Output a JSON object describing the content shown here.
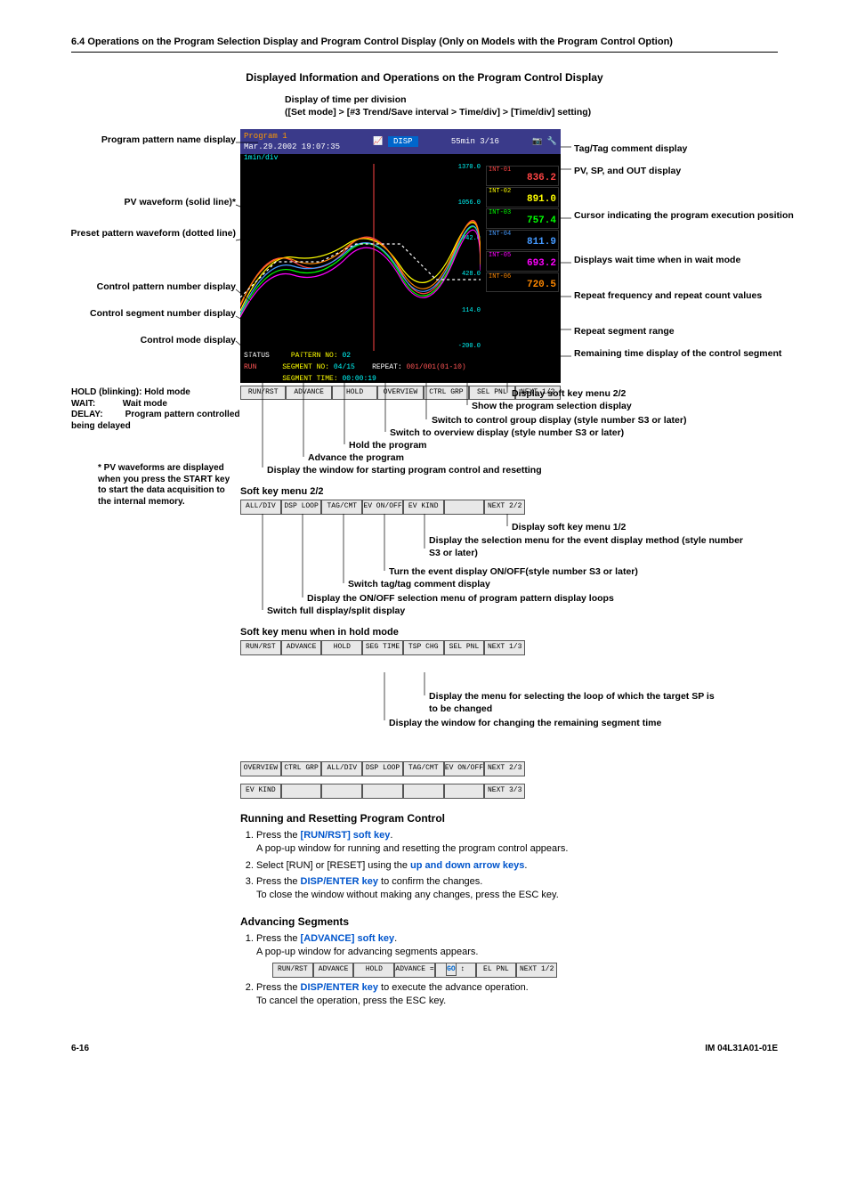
{
  "header": "6.4  Operations on the Program Selection Display and Program Control Display (Only on Models with the Program Control Option)",
  "title": "Displayed Information and Operations on the Program Control Display",
  "time_div_caption_1": "Display of time per division",
  "time_div_caption_2": "([Set mode] > [#3 Trend/Save interval > Time/div] > [Time/div] setting)",
  "labels_left": {
    "program_pattern": "Program pattern name display",
    "pv_wave": "PV waveform (solid line)*",
    "preset": "Preset pattern waveform (dotted line)",
    "ctrl_pattern": "Control pattern number display",
    "ctrl_segment": "Control segment number display",
    "ctrl_mode": "Control mode display"
  },
  "labels_right": {
    "tag": "Tag/Tag comment display",
    "pvspout": "PV, SP, and OUT display",
    "cursor": "Cursor indicating the program execution position",
    "wait": "Displays wait time when in wait mode",
    "repeat_freq": "Repeat frequency and repeat count values",
    "repeat_range": "Repeat segment range",
    "remaining": "Remaining time display of the control segment"
  },
  "mode_notes": {
    "hold": "HOLD (blinking): Hold mode",
    "wait_k": "WAIT:",
    "wait_v": "Wait mode",
    "delay_k": "DELAY:",
    "delay_v": "Program pattern controlled being delayed"
  },
  "pv_note": "* PV waveforms are displayed when you press the START key to start the data acquisition to the internal memory.",
  "softkey_desc": {
    "next": "Display soft key menu 2/2",
    "selpnl": "Show the program selection display",
    "ctrlgrp": "Switch to control group display (style number S3 or later)",
    "overview": "Switch to overview display (style number S3 or later)",
    "hold": "Hold the program",
    "advance": "Advance the program",
    "runrst": "Display the window for starting program control and resetting"
  },
  "sk2_title": "Soft key menu 2/2",
  "sk2_desc": {
    "next": "Display soft key menu 1/2",
    "evkind": "Display the selection menu for the event display method (style number S3 or later)",
    "evonoff": "Turn the event display ON/OFF(style number S3 or later)",
    "tagcmt": "Switch tag/tag comment display",
    "dsploop": "Display the ON/OFF selection menu of program pattern display loops",
    "alldiv": "Switch full display/split display"
  },
  "hold_title": "Soft key menu when in hold mode",
  "hold_desc": {
    "tspchg": "Display the menu for selecting the loop of which the target SP is to be changed",
    "segtime": "Display the window for changing the remaining segment time"
  },
  "screenshot": {
    "program_name": "Program 1",
    "datetime": "Mar.29.2002 19:07:35",
    "disp": "DISP",
    "time_info": "55min  3/16",
    "time_div": "1min/div",
    "status_label": "STATUS",
    "status_val": "RUN",
    "pattern_label": "PATTERN NO:",
    "pattern_val": "02",
    "segment_label": "SEGMENT NO:",
    "segment_val": "04/15",
    "repeat_label": "REPEAT:",
    "repeat_val": "001/001(01-10)",
    "segtime_label": "SEGMENT TIME:",
    "segtime_val": "00:00:19",
    "y_ticks": [
      "1370.0",
      "1056.0",
      "742.0",
      "428.0",
      "114.0",
      "-200.0"
    ],
    "softkeys1": [
      "RUN/RST",
      "ADVANCE",
      "HOLD",
      "OVERVIEW",
      "CTRL GRP",
      "SEL PNL",
      "NEXT 1/2"
    ],
    "tags": [
      {
        "name": "INT-01",
        "val": "836.2",
        "color": "#ff4444"
      },
      {
        "name": "INT-02",
        "val": "891.0",
        "color": "#ffff00"
      },
      {
        "name": "INT-03",
        "val": "757.4",
        "color": "#00ff00"
      },
      {
        "name": "INT-04",
        "val": "811.9",
        "color": "#4499ff"
      },
      {
        "name": "INT-05",
        "val": "693.2",
        "color": "#ff00ff"
      },
      {
        "name": "INT-06",
        "val": "720.5",
        "color": "#ff8800"
      }
    ]
  },
  "softkeys2": [
    "ALL/DIV",
    "DSP LOOP",
    "TAG/CMT",
    "EV ON/OFF",
    "EV KIND",
    "",
    "NEXT 2/2"
  ],
  "softkeys_hold1": [
    "RUN/RST",
    "ADVANCE",
    "HOLD",
    "SEG TIME",
    "TSP CHG",
    "SEL PNL",
    "NEXT 1/3"
  ],
  "softkeys_hold2": [
    "OVERVIEW",
    "CTRL GRP",
    "ALL/DIV",
    "DSP LOOP",
    "TAG/CMT",
    "EV ON/OFF",
    "NEXT 2/3"
  ],
  "softkeys_hold3": [
    "EV KIND",
    "",
    "",
    "",
    "",
    "",
    "NEXT 3/3"
  ],
  "softkeys_adv": [
    "RUN/RST",
    "ADVANCE",
    "HOLD",
    "ADVANCE =",
    "GO",
    "EL PNL",
    "NEXT 1/2"
  ],
  "body": {
    "run_title": "Running and Resetting Program Control",
    "run_1a": "Press the ",
    "run_1b": "[RUN/RST] soft key",
    "run_1c": ".",
    "run_1_sub": "A pop-up window for running and resetting the program control appears.",
    "run_2a": "Select [RUN] or [RESET] using the ",
    "run_2b": "up and down arrow keys",
    "run_2c": ".",
    "run_3a": "Press the ",
    "run_3b": "DISP/ENTER key",
    "run_3c": " to confirm the changes.",
    "run_3_sub": "To close the window without making any changes, press the ESC key.",
    "adv_title": "Advancing Segments",
    "adv_1a": "Press the ",
    "adv_1b": "[ADVANCE] soft key",
    "adv_1c": ".",
    "adv_1_sub": "A pop-up window for advancing segments appears.",
    "adv_2a": "Press the ",
    "adv_2b": "DISP/ENTER key",
    "adv_2c": " to execute the advance operation.",
    "adv_2_sub": "To cancel the operation, press the ESC key."
  },
  "footer": {
    "page": "6-16",
    "doc": "IM 04L31A01-01E"
  }
}
